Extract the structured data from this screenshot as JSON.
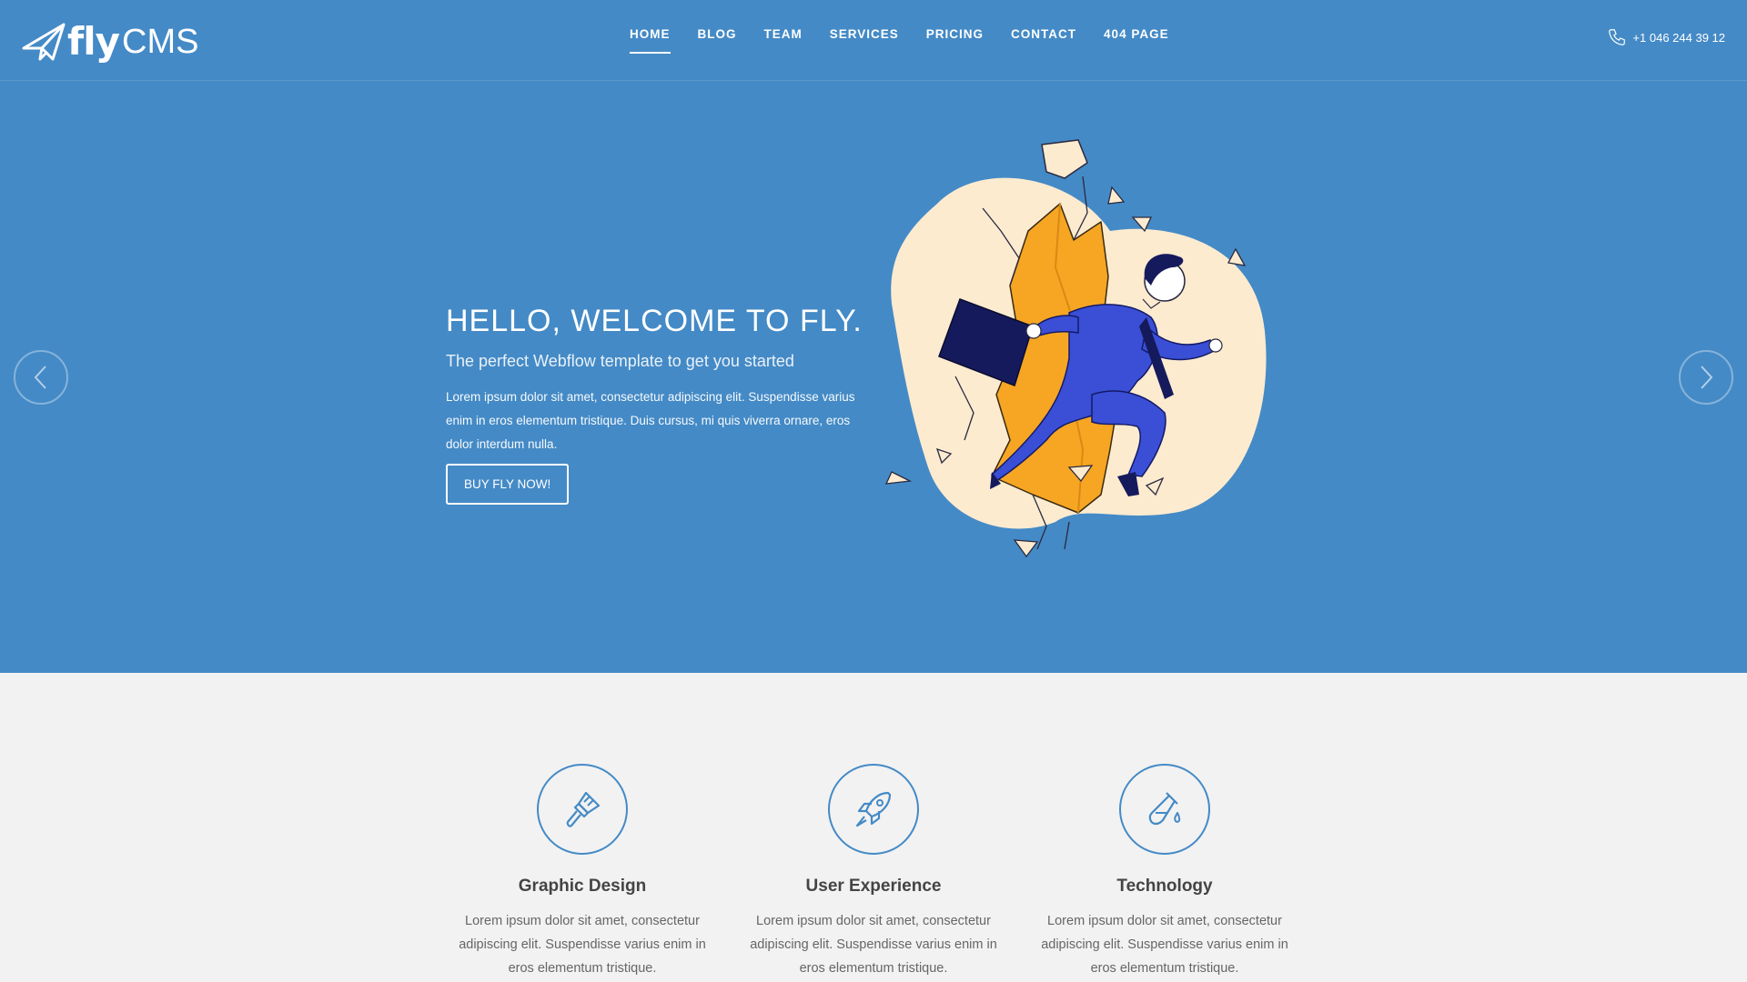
{
  "brand": {
    "fly": "fly",
    "cms": "CMS"
  },
  "nav": {
    "items": [
      {
        "label": "HOME",
        "active": true
      },
      {
        "label": "BLOG"
      },
      {
        "label": "TEAM"
      },
      {
        "label": "SERVICES"
      },
      {
        "label": "PRICING"
      },
      {
        "label": "CONTACT"
      },
      {
        "label": "404 PAGE"
      }
    ]
  },
  "phone": {
    "number": "+1 046 244 39 12",
    "icon": "phone-icon"
  },
  "hero": {
    "title": "HELLO, WELCOME TO FLY.",
    "subtitle": "The perfect Webflow template to get you started",
    "body": "Lorem ipsum dolor sit amet, consectetur adipiscing elit. Suspendisse varius enim in eros elementum tristique. Duis cursus, mi quis viverra ornare, eros dolor interdum nulla.",
    "button": "BUY FLY NOW!",
    "prev_icon": "chevron-left-icon",
    "next_icon": "chevron-right-icon"
  },
  "features": [
    {
      "title": "Graphic Design",
      "icon": "paintbrush-icon",
      "text": "Lorem ipsum dolor sit amet, consectetur adipiscing elit. Suspendisse varius enim in eros elementum tristique."
    },
    {
      "title": "User Experience",
      "icon": "rocket-icon",
      "text": "Lorem ipsum dolor sit amet, consectetur adipiscing elit. Suspendisse varius enim in eros elementum tristique."
    },
    {
      "title": "Technology",
      "icon": "test-tube-icon",
      "text": "Lorem ipsum dolor sit amet, consectetur adipiscing elit. Suspendisse varius enim in eros elementum tristique."
    }
  ],
  "colors": {
    "primary": "#448ac6",
    "background": "#f2f2f2",
    "accent_orange": "#f6a623",
    "suit_blue": "#3a4fd6",
    "cream": "#fdebd0"
  }
}
